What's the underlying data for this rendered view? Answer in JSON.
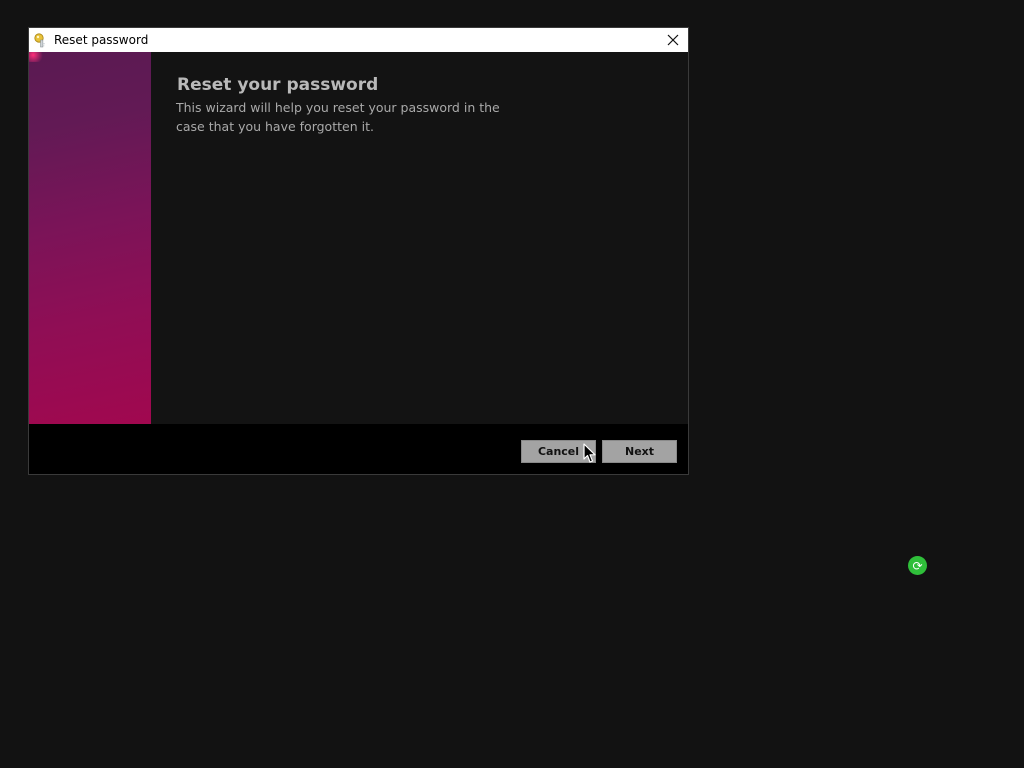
{
  "window": {
    "title": "Reset password",
    "title_icon": "key-icon",
    "close_icon": "close-icon"
  },
  "wizard": {
    "heading": "Reset your password",
    "description": "This wizard will help you reset your password in the case that you have forgotten it.",
    "banner_colors": [
      "#5a1a52",
      "#a1084f"
    ]
  },
  "buttons": {
    "cancel_label": "Cancel",
    "next_label": "Next"
  },
  "desktop": {
    "tray_icon": "sync-icon",
    "tray_icon_glyph": "⟳",
    "tray_icon_color": "#2fbf3a"
  }
}
